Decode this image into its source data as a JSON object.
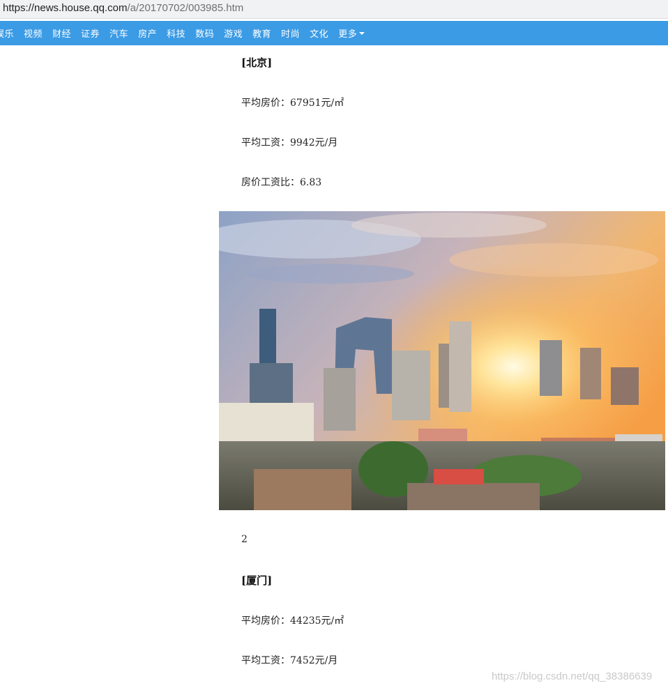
{
  "browser": {
    "url_host": "https://news.house.qq.com",
    "url_path": "/a/20170702/003985.htm"
  },
  "nav": {
    "items": [
      "娱乐",
      "视频",
      "财经",
      "证券",
      "汽车",
      "房产",
      "科技",
      "数码",
      "游戏",
      "教育",
      "时尚",
      "文化"
    ],
    "more_label": "更多",
    "bar_color": "#3b9be5"
  },
  "article": {
    "beijing": {
      "title": "[北京]",
      "avg_price": "平均房价：67951元/㎡",
      "avg_salary": "平均工资：9942元/月",
      "ratio": "房价工资比：6.83"
    },
    "image_caption_number": "2",
    "xiamen": {
      "title": "[厦门]",
      "avg_price": "平均房价：44235元/㎡",
      "avg_salary": "平均工资：7452元/月"
    }
  },
  "watermark": "https://blog.csdn.net/qq_38386639",
  "photo": {
    "icon": "beijing-skyline-sunset-photo"
  }
}
